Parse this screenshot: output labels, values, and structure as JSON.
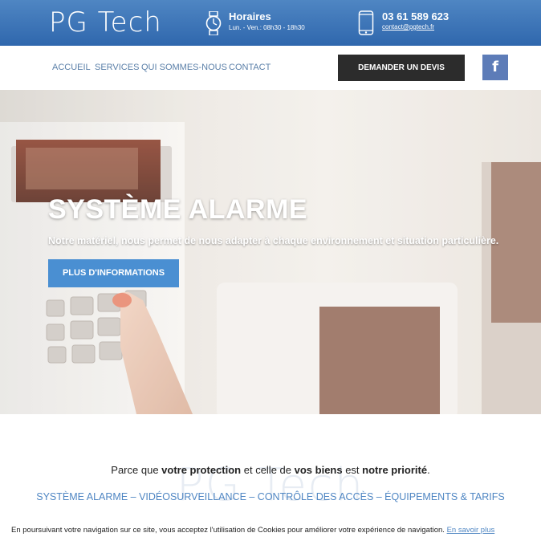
{
  "header": {
    "logo": "PG Tech",
    "hours_title": "Horaires",
    "hours_text": "Lun. - Ven.: 08h30 - 18h30",
    "phone": "03 61 589 623",
    "email": "contact@pgtech.fr"
  },
  "nav": {
    "items": [
      "ACCUEIL",
      "SERVICES",
      "QUI SOMMES-NOUS",
      "CONTACT"
    ],
    "quote_label": "DEMANDER UN DEVIS",
    "facebook_label": "f"
  },
  "hero": {
    "title": "SYSTÈME ALARME",
    "subtitle": "Notre matériel, nous permet de nous adapter à chaque environnement et situation particulière.",
    "button_label": "PLUS D'INFORMATIONS"
  },
  "content": {
    "watermark": "PG Tech",
    "tagline_parts": [
      "Parce que ",
      "votre protection",
      " et celle de ",
      "vos biens",
      " est ",
      "notre priorité",
      "."
    ],
    "services_line": "SYSTÈME ALARME – VIDÉOSURVEILLANCE – CONTRÔLE DES ACCÈS – ÉQUIPEMENTS & TARIFS"
  },
  "cookie": {
    "text": "En poursuivant votre navigation sur ce site, vous acceptez l'utilisation de Cookies pour améliorer votre expérience de navigation.",
    "link": "En savoir plus"
  },
  "colors": {
    "accent": "#4f86c3",
    "header_bg": "#2f67ad",
    "button_dark": "#2c2c2c",
    "hero_button": "#4a8fd2",
    "facebook": "#5d7cb8"
  }
}
